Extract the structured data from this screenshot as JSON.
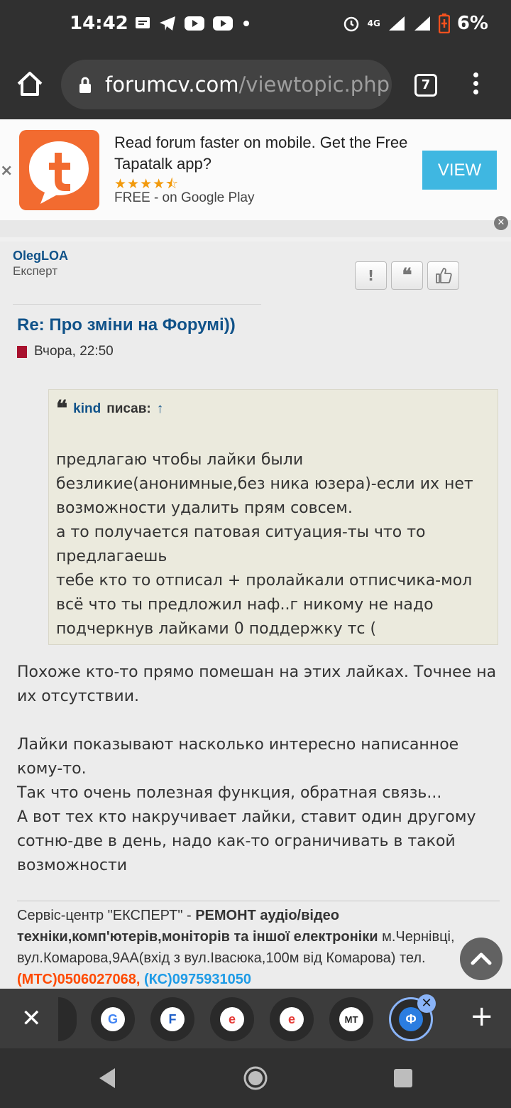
{
  "status_bar": {
    "time": "14:42",
    "battery": "6%",
    "network": "4G",
    "icons": [
      "message-icon",
      "telegram-icon",
      "youtube-icon",
      "youtube-icon",
      "dot-icon",
      "alarm-icon",
      "signal-icon",
      "battery-icon"
    ]
  },
  "browser": {
    "url_domain": "forumcv.com",
    "url_path": "/viewtopic.php",
    "tab_count": "7"
  },
  "banner": {
    "text": "Read forum faster on mobile. Get the Free Tapatalk app?",
    "stars": "★★★★⯪",
    "sub": "FREE - on Google Play",
    "button": "VIEW",
    "close": "×",
    "colors": {
      "logo": "#f26b30",
      "button": "#3fb7e1"
    }
  },
  "post": {
    "author": "OlegLOA",
    "rank": "Експерт",
    "action_report": "!",
    "action_quote": "❝",
    "title": "Re: Про зміни на Форумі))",
    "date": "Вчора, 22:50",
    "quote": {
      "user": "kind",
      "wrote": "писав:",
      "arrow": "↑",
      "lines": [
        "предлагаю чтобы лайки были безликие(анонимные,без ника юзера)-если их нет возможности удалить прям совсем.",
        "а то получается патовая ситуация-ты что то предлагаешь",
        "тебе кто то отписал + пролайкали отписчика-мол всё что ты предложил наф..г никому не надо подчеркнув лайками 0 поддержку тс ("
      ]
    },
    "message": {
      "p1": "Похоже кто-то прямо помешан на этих лайках. Точнее на их отсутствии.",
      "p2": "Лайки показывают насколько интересно написанное кому-то.",
      "p3": "Так что очень полезная функция, обратная связь...",
      "p4": "А вот тех кто накручивает лайки, ставит один другому сотню-две в день, надо как-то ограничивать в такой возможности"
    },
    "signature": {
      "part1": "Сервіс-центр \"ЕКСПЕРТ\" - ",
      "bold": "РЕМОНТ аудіо/відео техніки,комп'ютерів,моніторів та іншої електроніки",
      "part2": " м.Чернівці, вул.Комарова,9АА(вхід з вул.Івасюка,100м від Комарова) тел.",
      "phone1": "(МТС)0506027068,",
      "phone2": "(КС)0975931050"
    }
  },
  "tab_strip": {
    "close": "✕",
    "plus": "+",
    "tabs": [
      {
        "name": "google-tab",
        "glyph": "G"
      },
      {
        "name": "f-tab",
        "glyph": "F"
      },
      {
        "name": "e-tab",
        "glyph": "e"
      },
      {
        "name": "e-tab-2",
        "glyph": "e"
      },
      {
        "name": "mt-tab",
        "glyph": "MT"
      },
      {
        "name": "forum-tab",
        "glyph": "Ф"
      }
    ]
  }
}
